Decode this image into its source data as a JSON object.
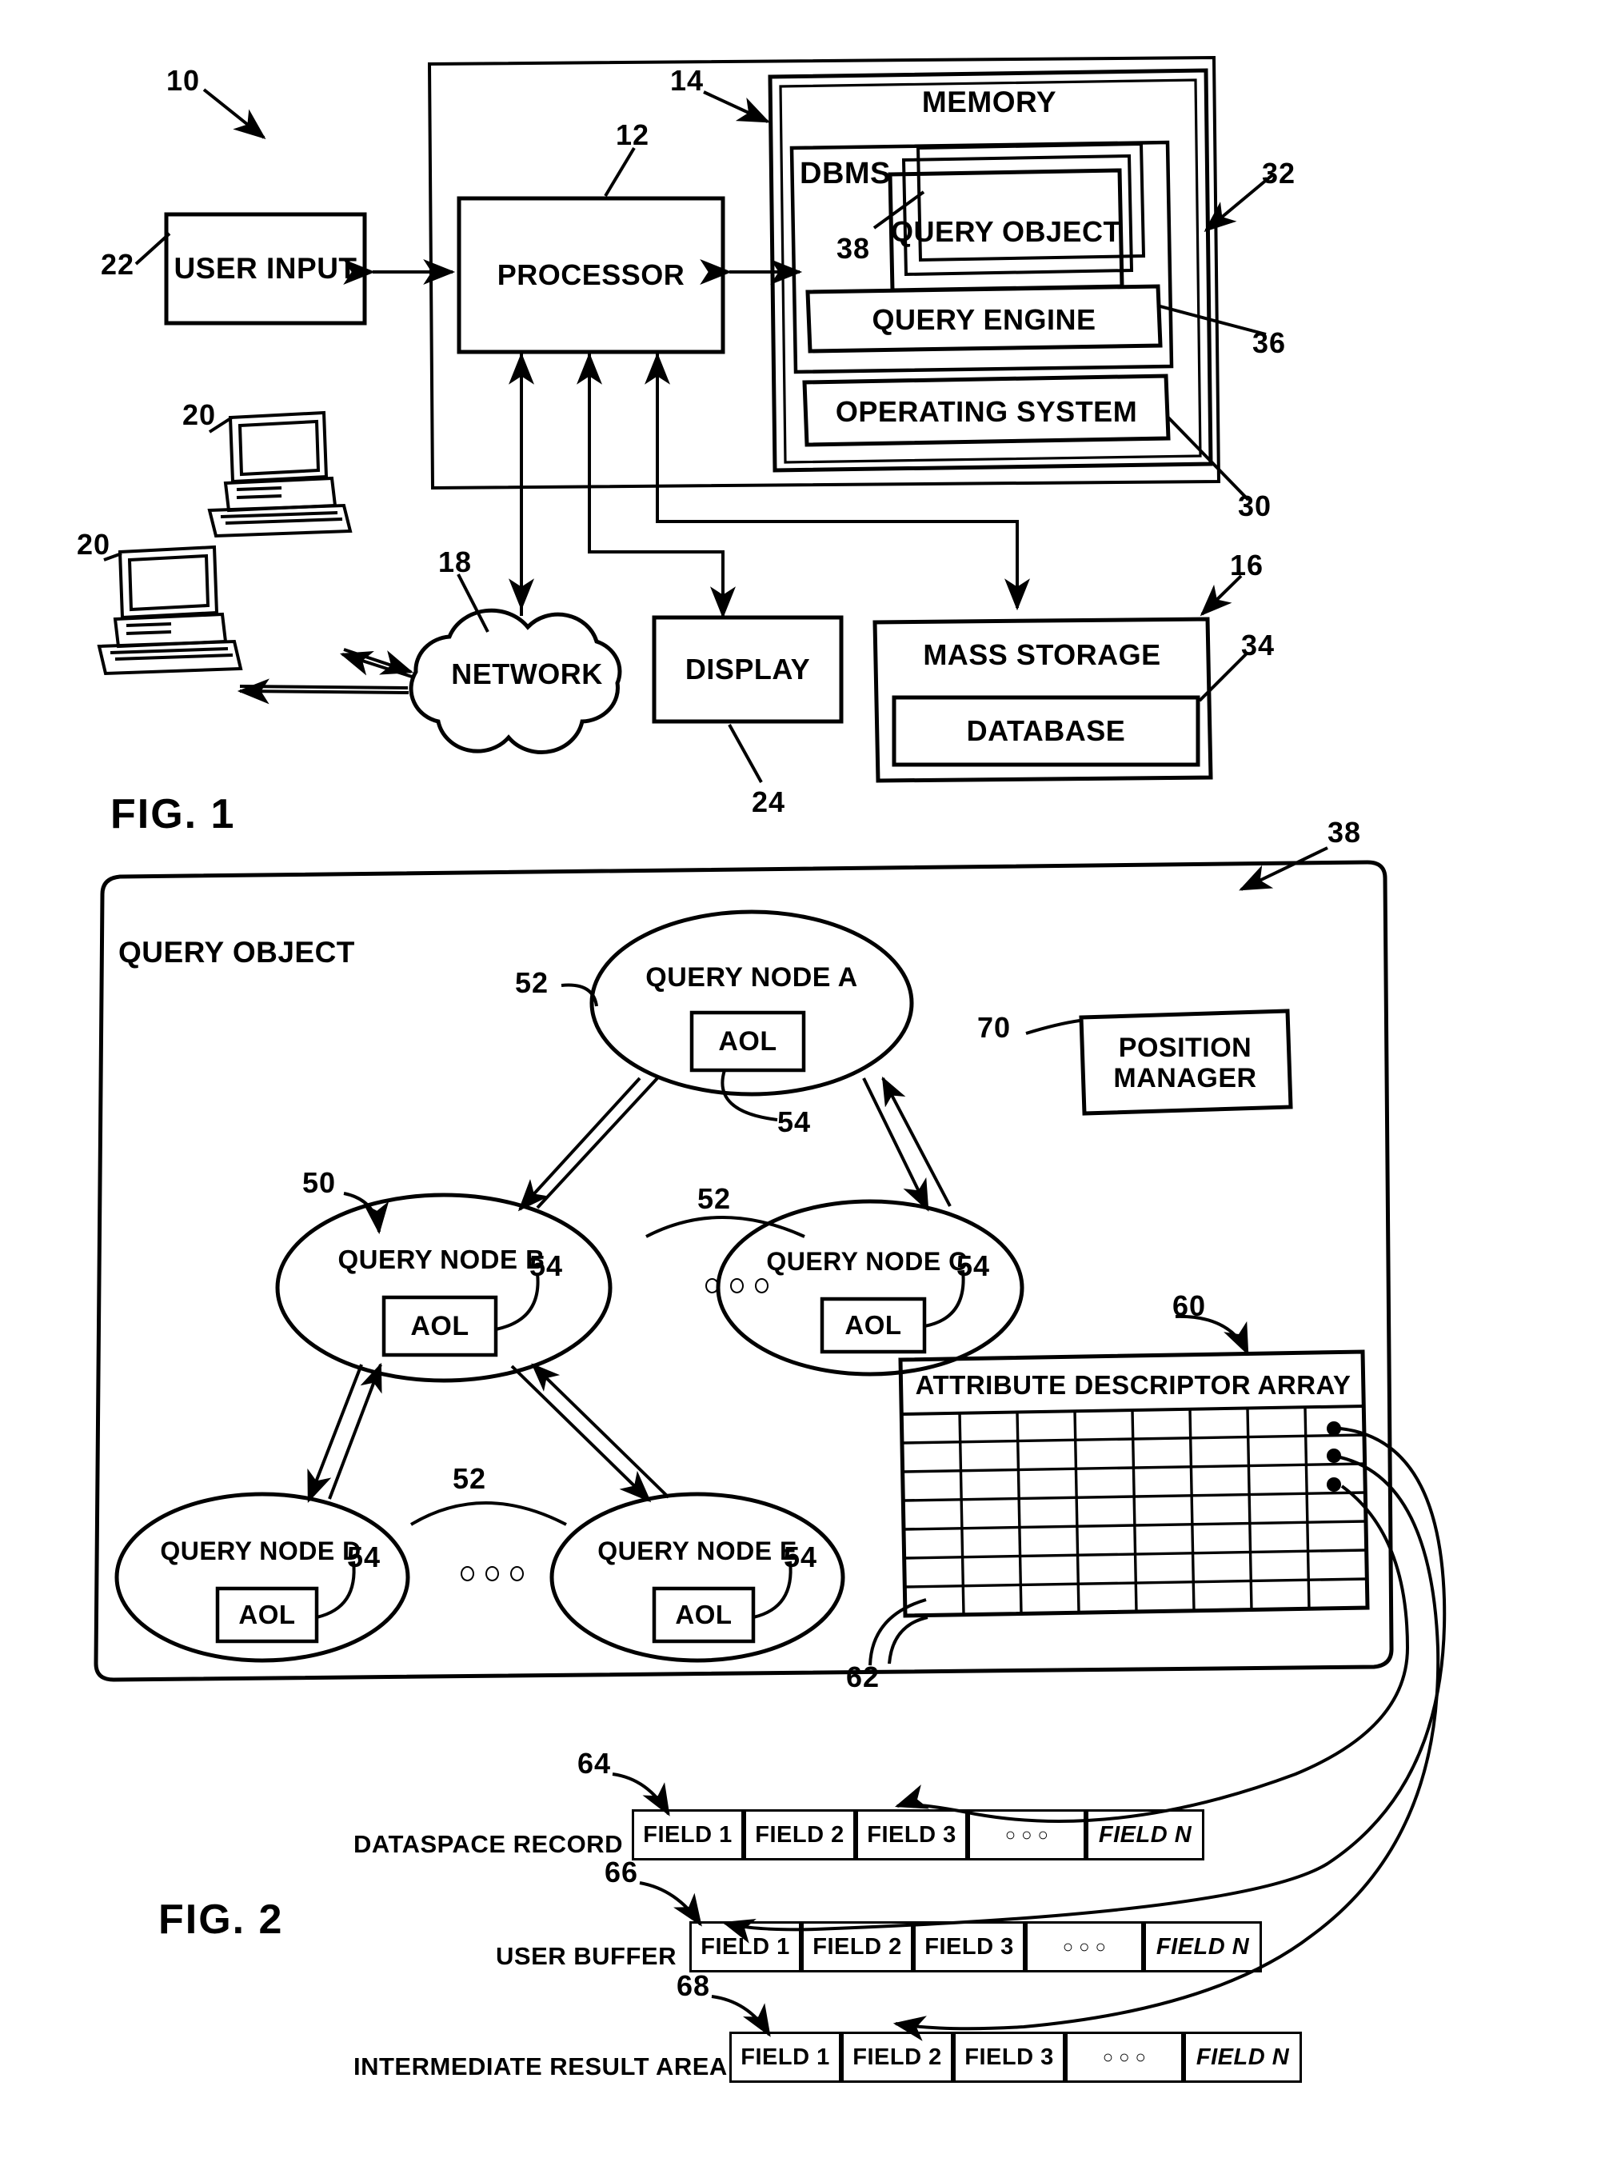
{
  "figures": {
    "fig1": {
      "label": "FIG. 1",
      "blocks": {
        "user_input": "USER INPUT",
        "processor": "PROCESSOR",
        "memory": "MEMORY",
        "dbms": "DBMS",
        "query_object": "QUERY OBJECT",
        "query_engine": "QUERY ENGINE",
        "operating_system": "OPERATING SYSTEM",
        "network": "NETWORK",
        "display": "DISPLAY",
        "mass_storage": "MASS STORAGE",
        "database": "DATABASE"
      },
      "refs": {
        "system": "10",
        "processor": "12",
        "memory": "14",
        "mass_storage": "16",
        "network": "18",
        "client": "20",
        "client2": "20",
        "user_input": "22",
        "display": "24",
        "operating_system": "30",
        "dbms": "32",
        "database": "34",
        "query_engine": "36",
        "query_object": "38"
      }
    },
    "fig2": {
      "label": "FIG. 2",
      "blocks": {
        "query_object": "QUERY OBJECT",
        "position_manager": "POSITION MANAGER",
        "attribute_descriptor_array": "ATTRIBUTE DESCRIPTOR ARRAY"
      },
      "nodes": [
        {
          "title": "QUERY NODE A",
          "aol": "AOL"
        },
        {
          "title": "QUERY NODE B",
          "aol": "AOL"
        },
        {
          "title": "QUERY NODE C",
          "aol": "AOL"
        },
        {
          "title": "QUERY NODE D",
          "aol": "AOL"
        },
        {
          "title": "QUERY NODE E",
          "aol": "AOL"
        }
      ],
      "refs": {
        "query_object": "38",
        "node_group": "50",
        "link_a": "52",
        "link_b": "52",
        "link_c": "52",
        "aol_a": "54",
        "aol_b": "54",
        "aol_c": "54",
        "aol_d": "54",
        "aol_e": "54",
        "array": "60",
        "array_cell": "62",
        "dataspace_record": "64",
        "user_buffer": "66",
        "intermediate_result_area": "68",
        "position_manager": "70"
      },
      "buffers": [
        {
          "name": "DATASPACE RECORD",
          "ref": "64",
          "cells": [
            "FIELD 1",
            "FIELD 2",
            "FIELD 3",
            "○ ○ ○",
            "FIELD N"
          ]
        },
        {
          "name": "USER BUFFER",
          "ref": "66",
          "cells": [
            "FIELD 1",
            "FIELD 2",
            "FIELD 3",
            "○ ○ ○",
            "FIELD N"
          ]
        },
        {
          "name": "INTERMEDIATE RESULT AREA",
          "ref": "68",
          "cells": [
            "FIELD 1",
            "FIELD 2",
            "FIELD 3",
            "○ ○ ○",
            "FIELD N"
          ]
        }
      ],
      "array_grid": {
        "cols": 8,
        "rows": 7
      }
    }
  }
}
